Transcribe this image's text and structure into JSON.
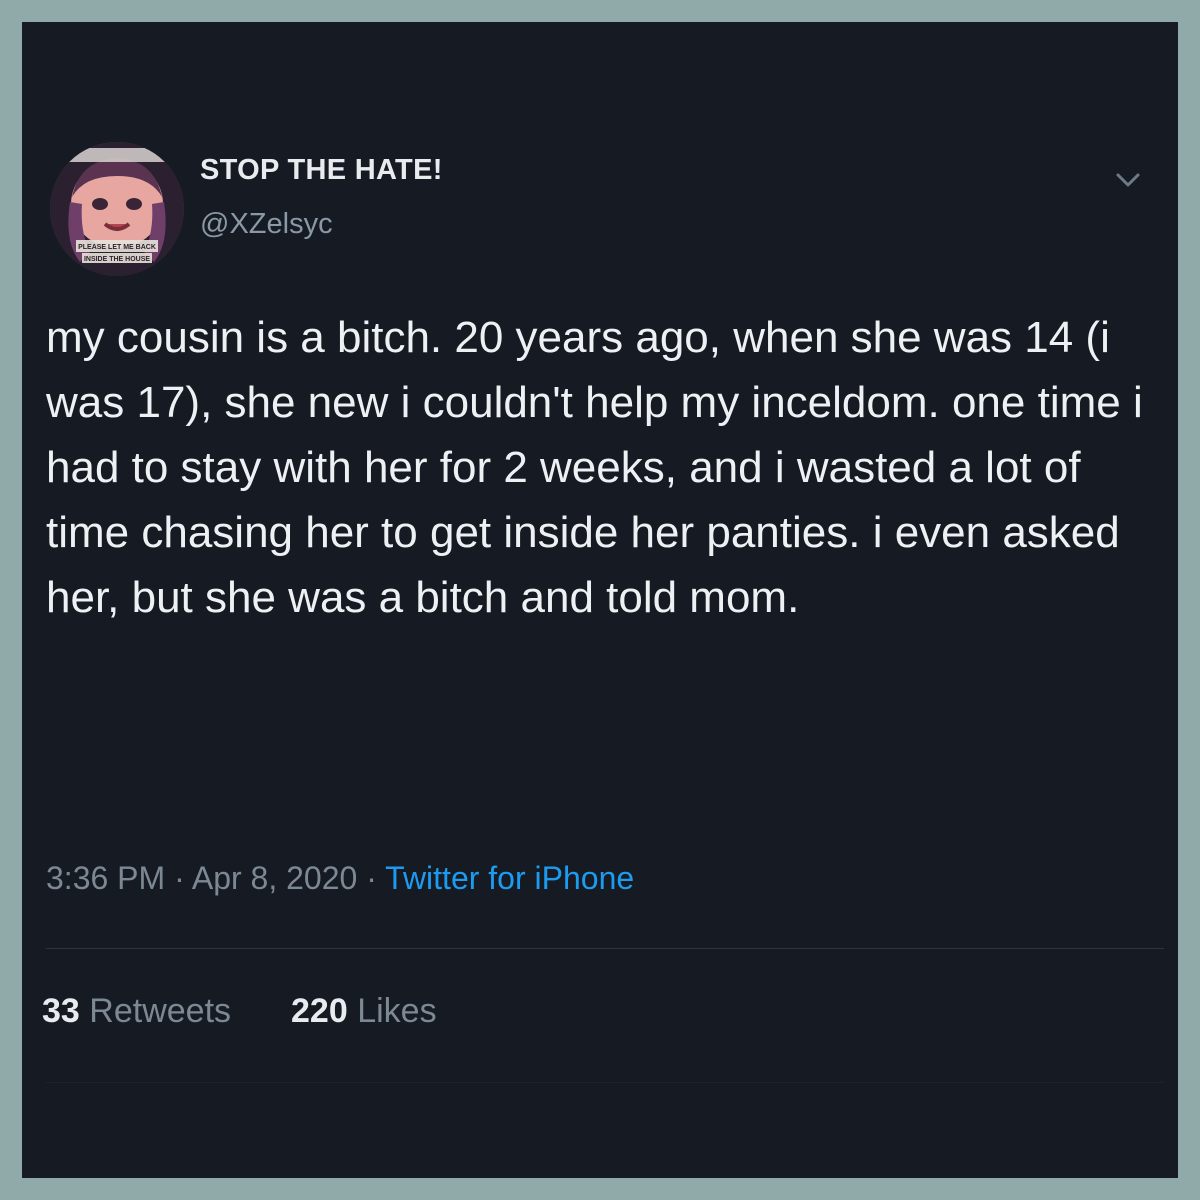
{
  "tweet": {
    "display_name": "STOP THE HATE!",
    "handle": "@XZelsyc",
    "text": "my cousin is a bitch. 20 years ago, when she was 14 (i was 17), she new i couldn't help my inceldom. one time i had to stay with her for 2 weeks, and i wasted a lot of time chasing her to get inside her panties. i even asked her, but she was a bitch and told mom.",
    "time": "3:36 PM",
    "separator": " · ",
    "date": "Apr 8, 2020",
    "source": "Twitter for iPhone",
    "retweets_count": "33",
    "retweets_label": "Retweets",
    "likes_count": "220",
    "likes_label": "Likes",
    "avatar_caption": "PLEASE LET ME BACK INSIDE THE HOUSE"
  },
  "icons": {
    "menu": "chevron-down-icon"
  },
  "colors": {
    "background": "#151a23",
    "frame": "#8faaa8",
    "primary_text": "#eef1f3",
    "secondary_text": "#8b98a5",
    "link": "#1d9bf0"
  }
}
